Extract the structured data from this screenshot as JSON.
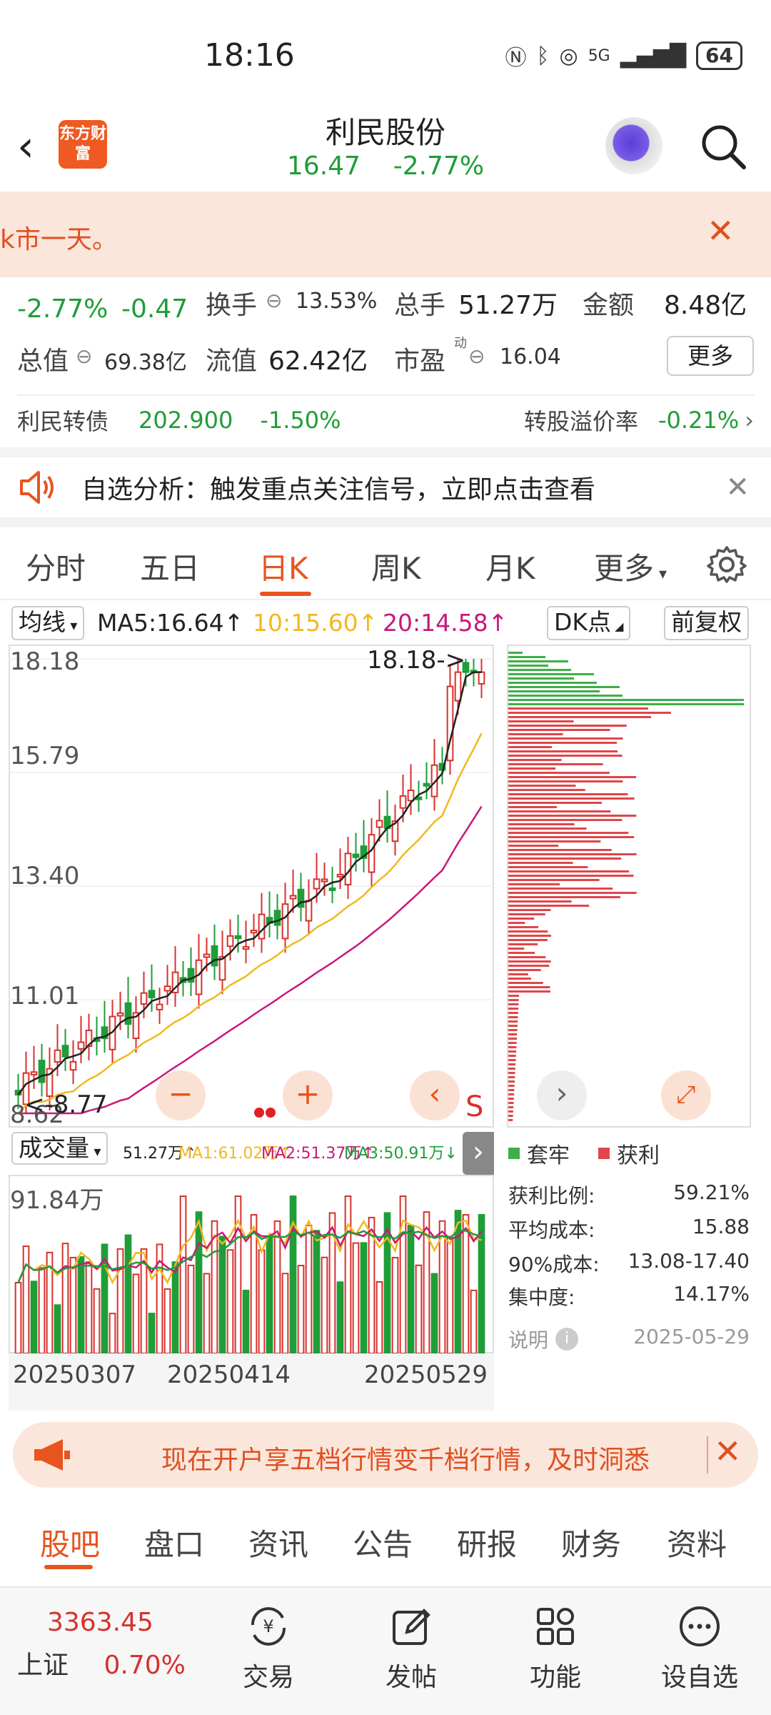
{
  "status_bar": {
    "time": "18:16",
    "battery": "64",
    "signal": "5G"
  },
  "header": {
    "logo_text": "东方财富",
    "title": "利民股份",
    "price": "16.47",
    "change_pct": "-2.77%"
  },
  "banner": {
    "text": "k市一天。"
  },
  "quote": {
    "change_pct": "-2.77%",
    "change_abs": "-0.47",
    "turnover_label": "换手",
    "turnover_value": "13.53%",
    "volume_label": "总手",
    "volume_value": "51.27万",
    "amount_label": "金额",
    "amount_value": "8.48亿",
    "mktcap_label": "总值",
    "mktcap_value": "69.38亿",
    "float_label": "流值",
    "float_value": "62.42亿",
    "pe_label": "市盈",
    "pe_sup": "动",
    "pe_value": "16.04",
    "more_btn": "更多"
  },
  "bond": {
    "name": "利民转债",
    "price": "202.900",
    "change": "-1.50%",
    "premium_label": "转股溢价率",
    "premium_value": "-0.21%"
  },
  "alert": {
    "text": "自选分析：触发重点关注信号，立即点击查看"
  },
  "kline_tabs": [
    "分时",
    "五日",
    "日K",
    "周K",
    "月K",
    "更多"
  ],
  "kline_active": "日K",
  "toolbar": {
    "ma_select": "均线",
    "ma5": "MA5:16.64",
    "ma10": "10:15.60",
    "ma20": "20:14.58",
    "dk": "DK点",
    "adjust": "前复权"
  },
  "colors": {
    "up": "#d8302c",
    "down": "#1f9d38",
    "ma5": "#222222",
    "ma10": "#f2b820",
    "ma20": "#c8197a",
    "accent": "#e8541e"
  },
  "chart_data": [
    {
      "type": "candlestick",
      "y_ticks": [
        "18.18",
        "15.79",
        "13.40",
        "11.01",
        "8.62"
      ],
      "ylim": [
        8.62,
        18.18
      ],
      "high_label": "18.18->",
      "low_label": "<-8.77",
      "ma_series": [
        {
          "name": "MA5",
          "value": 16.64,
          "color": "#222222"
        },
        {
          "name": "MA10",
          "value": 15.6,
          "color": "#f2b820"
        },
        {
          "name": "MA20",
          "value": 14.58,
          "color": "#c8197a"
        }
      ],
      "grid": true
    },
    {
      "type": "bar",
      "title": "成交量",
      "readout": "51.27万",
      "ma_labels": [
        "MA1:61.02万",
        "MA2:51.37万",
        "MA3:50.91万"
      ],
      "y_tick": "91.84万",
      "x_ticks": [
        "20250307",
        "20250414",
        "20250529"
      ]
    },
    {
      "type": "bar",
      "orientation": "horizontal",
      "legend": [
        "套牢",
        "获利"
      ],
      "stats": [
        {
          "label": "获利比例:",
          "value": "59.21%"
        },
        {
          "label": "平均成本:",
          "value": "15.88"
        },
        {
          "label": "90%成本:",
          "value": "13.08-17.40"
        },
        {
          "label": "集中度:",
          "value": "14.17%"
        }
      ],
      "note_label": "说明",
      "date": "2025-05-29"
    }
  ],
  "volume_panel": {
    "label": "成交量",
    "readout": "51.27万",
    "ma1": "MA1:61.02万",
    "ma2": "MA2:51.37万",
    "ma3": "MA3:50.91万",
    "max": "91.84万",
    "dates": [
      "20250307",
      "20250414",
      "20250529"
    ]
  },
  "chip_panel": {
    "legend_trapped": "套牢",
    "legend_profit": "获利",
    "profit_ratio_label": "获利比例:",
    "profit_ratio": "59.21%",
    "avg_cost_label": "平均成本:",
    "avg_cost": "15.88",
    "cost90_label": "90%成本:",
    "cost90": "13.08-17.40",
    "concentration_label": "集中度:",
    "concentration": "14.17%",
    "note": "说明",
    "date": "2025-05-29"
  },
  "chart_controls": {
    "s_mark": "S"
  },
  "promo": {
    "text": "现在开户享五档行情变千档行情，及时洞悉"
  },
  "bottom_tabs": [
    "股吧",
    "盘口",
    "资讯",
    "公告",
    "研报",
    "财务",
    "资料"
  ],
  "nav": {
    "index_value": "3363.45",
    "index_name": "上证",
    "index_change": "0.70%",
    "trade": "交易",
    "post": "发帖",
    "func": "功能",
    "watch": "设自选"
  }
}
